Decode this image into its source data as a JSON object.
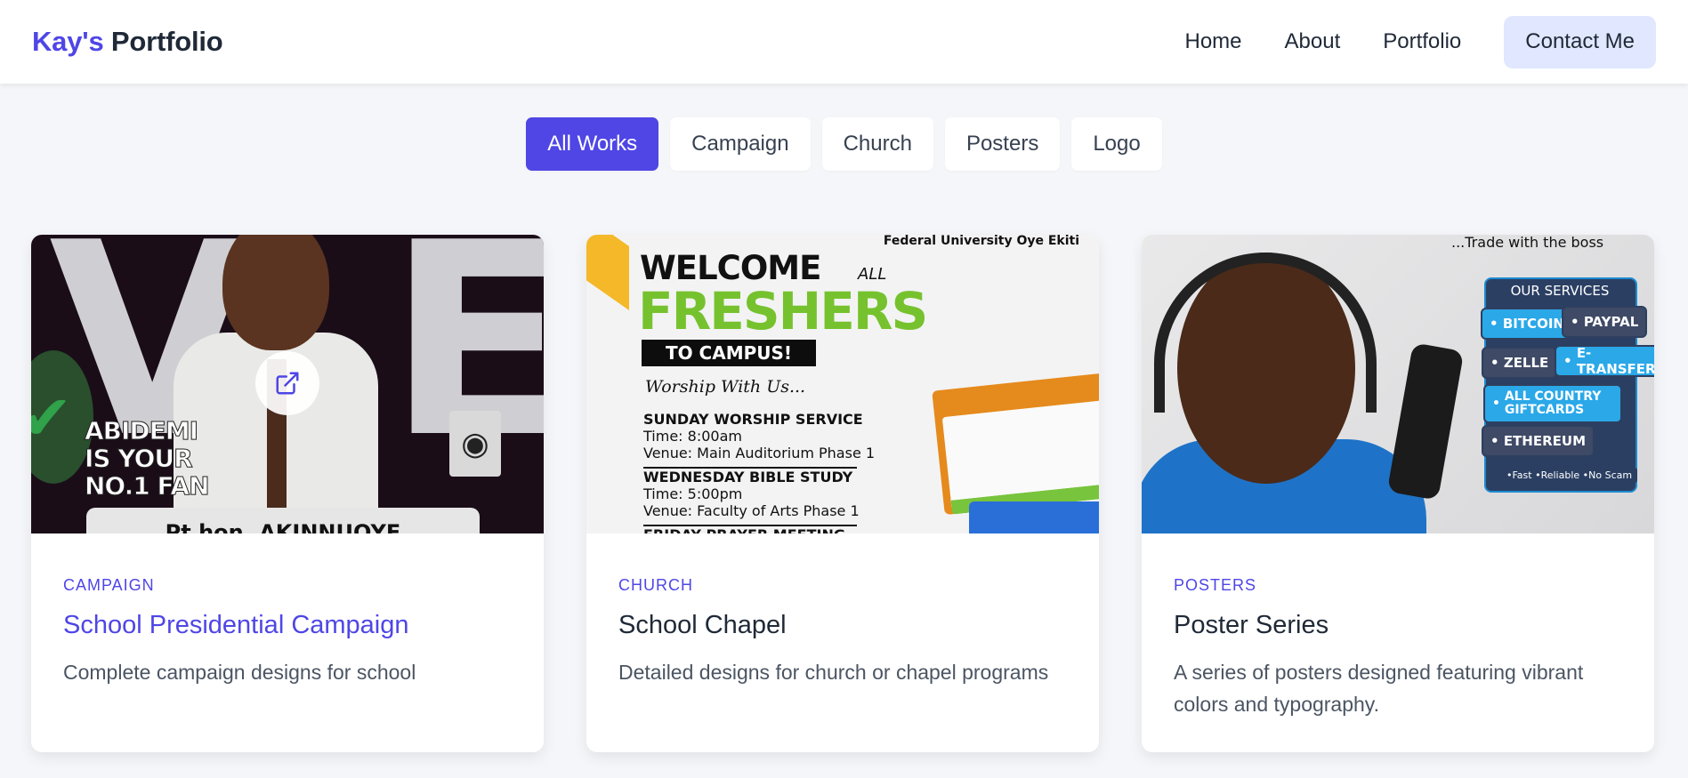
{
  "brand": {
    "first": "Kay's",
    "second": "Portfolio"
  },
  "nav": {
    "items": [
      "Home",
      "About",
      "Portfolio"
    ],
    "contact": "Contact Me"
  },
  "filters": {
    "items": [
      "All Works",
      "Campaign",
      "Church",
      "Posters",
      "Logo"
    ],
    "active": "All Works"
  },
  "cards": [
    {
      "category": "CAMPAIGN",
      "title": "School Presidential Campaign",
      "description": "Complete campaign designs for school",
      "thumb": {
        "fan_text": [
          "ABIDEMI",
          "IS YOUR",
          "NO.1 FAN"
        ],
        "banner": "Pt hon. AKINNUOYE"
      }
    },
    {
      "category": "CHURCH",
      "title": "School Chapel",
      "description": "Detailed designs for church or chapel programs",
      "thumb": {
        "university": "Federal University Oye Ekiti",
        "welcome": "WELCOME",
        "all": "ALL",
        "freshers": "FRESHERS",
        "to_campus": "TO CAMPUS!",
        "worship": "Worship With Us...",
        "s1_title": "SUNDAY WORSHIP SERVICE",
        "s1_time": "Time: 8:00am",
        "s1_venue": "Venue: Main Auditorium Phase 1",
        "s2_title": "WEDNESDAY BIBLE STUDY",
        "s2_time": "Time: 5:00pm",
        "s2_venue": "Venue: Faculty of Arts Phase 1",
        "s3_title": "FRIDAY PRAYER MEETING"
      }
    },
    {
      "category": "POSTERS",
      "title": "Poster Series",
      "description": "A series of posters designed featuring vibrant colors and typography.",
      "thumb": {
        "tagline": "...Trade with the boss",
        "services_title": "OUR SERVICES",
        "services": [
          "BITCOIN",
          "PAYPAL",
          "ZELLE",
          "E-TRANSFER",
          "ALL COUNTRY GIFTCARDS",
          "ETHEREUM"
        ],
        "footer": "•Fast •Reliable •No Scam"
      }
    }
  ],
  "colors": {
    "accent": "#4f46e5",
    "accent_soft": "#e0e7ff",
    "background": "#f5f6f9"
  },
  "icons": {
    "external_link": "external-link-icon"
  }
}
